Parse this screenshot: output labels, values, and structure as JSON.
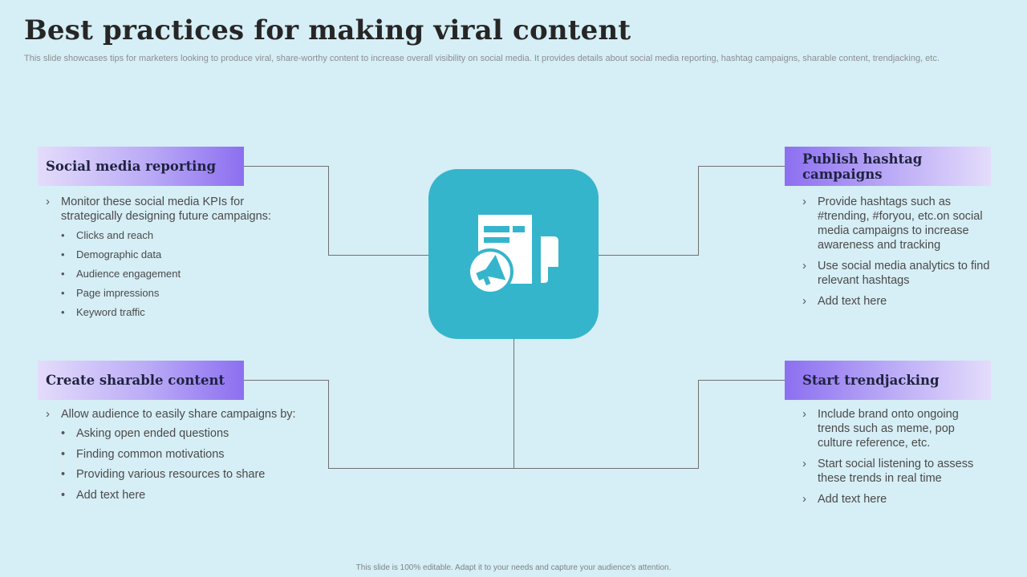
{
  "title": "Best practices for making viral content",
  "subtitle": "This slide showcases tips for marketers looking to produce viral, share-worthy content to increase overall visibility on social media. It provides details about social media reporting, hashtag campaigns, sharable content, trendjacking, etc.",
  "center_icon": "newspaper-megaphone-icon",
  "sections": {
    "social_media_reporting": {
      "heading": "Social media reporting",
      "intro": "Monitor these social media KPIs for strategically designing future campaigns:",
      "items": [
        "Clicks and reach",
        "Demographic  data",
        "Audience engagement",
        "Page impressions",
        "Keyword traffic"
      ]
    },
    "create_sharable_content": {
      "heading": "Create sharable content",
      "intro": "Allow audience to easily share campaigns by:",
      "items": [
        "Asking open ended questions",
        "Finding common motivations",
        "Providing various resources to share",
        "Add text here"
      ]
    },
    "publish_hashtag_campaigns": {
      "heading": "Publish hashtag campaigns",
      "points": [
        "Provide hashtags such as #trending, #foryou, etc.on social media campaigns to increase awareness and tracking",
        "Use social media analytics to find relevant hashtags",
        "Add text here"
      ]
    },
    "start_trendjacking": {
      "heading": "Start trendjacking",
      "points": [
        "Include brand onto ongoing trends such as meme, pop culture reference, etc.",
        "Start social listening to assess these trends in real time",
        "Add text here"
      ]
    }
  },
  "footer": "This slide is 100% editable.  Adapt it to your needs and capture your audience's attention.",
  "colors": {
    "background": "#d6eef5",
    "hub": "#35b5cc",
    "header_gradient_dark": "#8c6ff0",
    "header_gradient_light": "#e4dcfb",
    "connector": "#707070"
  }
}
